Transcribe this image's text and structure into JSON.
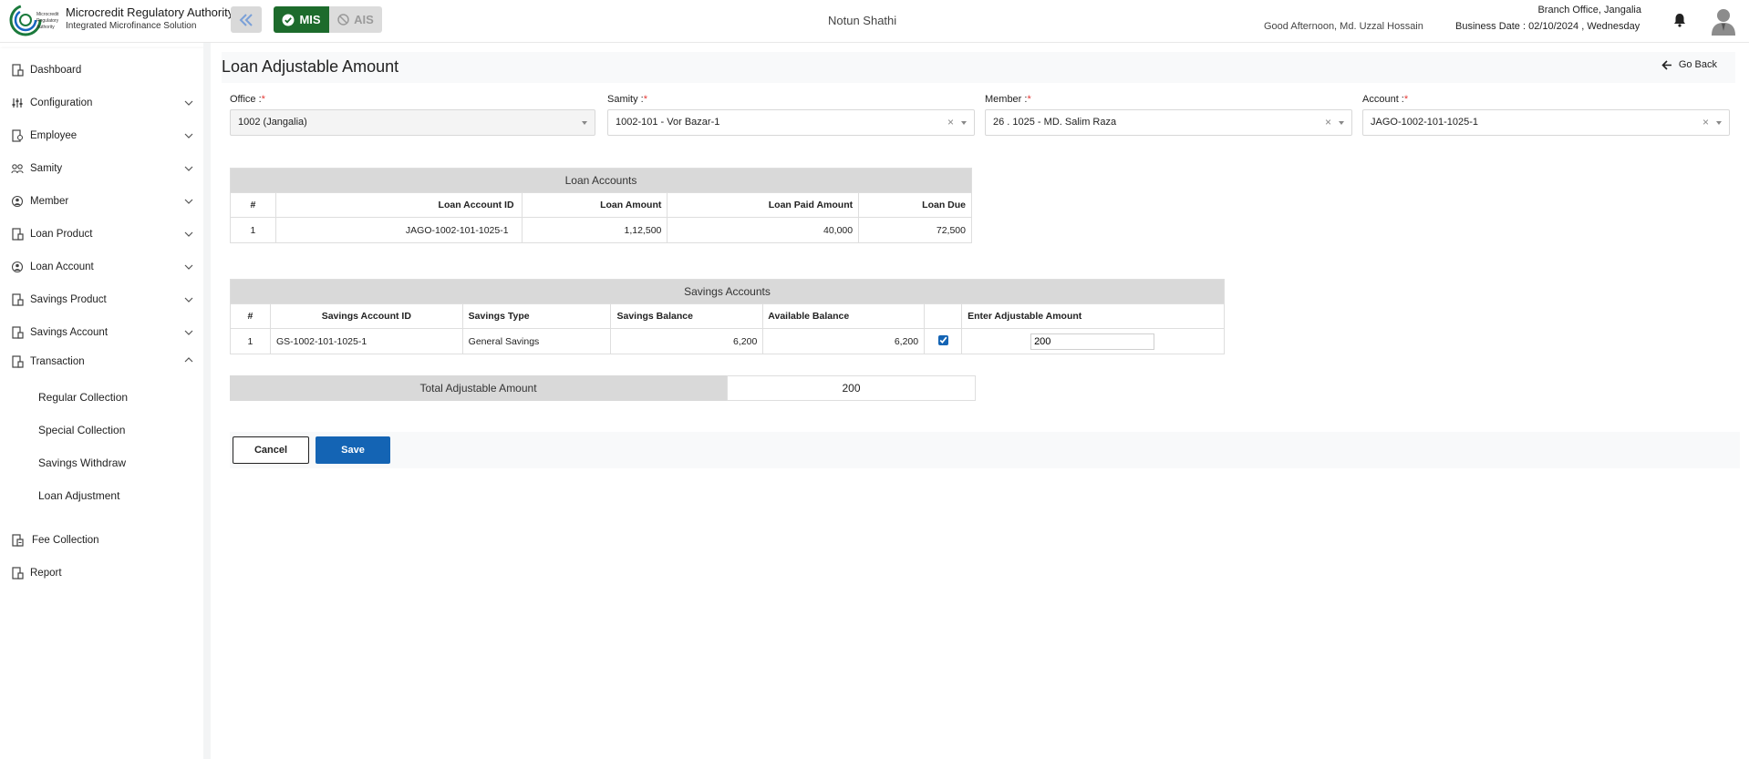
{
  "header": {
    "brand_title": "Microcredit Regulatory Authority",
    "brand_subtitle": "Integrated Microfinance Solution",
    "logo_text": [
      "Microcredit",
      "Regulatory",
      "Authority"
    ],
    "mis_label": "MIS",
    "ais_label": "AIS",
    "org_name": "Notun Shathi",
    "greeting": "Good Afternoon, Md. Uzzal Hossain",
    "branch": "Branch Office, Jangalia",
    "business_date": "Business Date : 02/10/2024 , Wednesday"
  },
  "sidebar": {
    "items": [
      {
        "label": "Dashboard",
        "icon": "dashboard-icon"
      },
      {
        "label": "Configuration",
        "icon": "sliders-icon"
      },
      {
        "label": "Employee",
        "icon": "employee-icon"
      },
      {
        "label": "Samity",
        "icon": "group-icon"
      },
      {
        "label": "Member",
        "icon": "member-icon"
      },
      {
        "label": "Loan Product",
        "icon": "loan-product-icon"
      },
      {
        "label": "Loan Account",
        "icon": "loan-account-icon"
      },
      {
        "label": "Savings Product",
        "icon": "savings-product-icon"
      },
      {
        "label": "Savings Account",
        "icon": "savings-account-icon"
      },
      {
        "label": "Transaction",
        "icon": "transaction-icon"
      }
    ],
    "transaction_sub": [
      "Regular Collection",
      "Special Collection",
      "Savings Withdraw",
      "Loan Adjustment"
    ],
    "bottom_items": [
      {
        "label": "Fee Collection",
        "icon": "fee-icon"
      },
      {
        "label": "Report",
        "icon": "report-icon"
      }
    ]
  },
  "main": {
    "title": "Loan Adjustable Amount",
    "go_back": "Go Back",
    "filters": {
      "office": {
        "label": "Office :",
        "value": "1002 (Jangalia)"
      },
      "samity": {
        "label": "Samity :",
        "value": "1002-101 - Vor Bazar-1"
      },
      "member": {
        "label": "Member :",
        "value": "26 . 1025 - MD. Salim Raza"
      },
      "account": {
        "label": "Account :",
        "value": "JAGO-1002-101-1025-1"
      },
      "required_mark": "*"
    },
    "loan_accounts": {
      "caption": "Loan Accounts",
      "headers": [
        "#",
        "Loan Account ID",
        "Loan Amount",
        "Loan Paid Amount",
        "Loan Due"
      ],
      "rows": [
        [
          "1",
          "JAGO-1002-101-1025-1",
          "1,12,500",
          "40,000",
          "72,500"
        ]
      ]
    },
    "savings_accounts": {
      "caption": "Savings Accounts",
      "headers": [
        "#",
        "Savings Account ID",
        "Savings Type",
        "Savings Balance",
        "Available Balance",
        "",
        "Enter Adjustable Amount"
      ],
      "rows": [
        [
          "1",
          "GS-1002-101-1025-1",
          "General Savings",
          "6,200",
          "6,200"
        ]
      ],
      "adjustable_amount": "200",
      "checked": true
    },
    "total": {
      "label": "Total Adjustable Amount",
      "value": "200"
    },
    "cancel_label": "Cancel",
    "save_label": "Save"
  },
  "colors": {
    "mis_green": "#1d6b2c",
    "save_blue": "#1464b4",
    "header_gray": "#d9d9d9",
    "required_red": "#e53935"
  }
}
